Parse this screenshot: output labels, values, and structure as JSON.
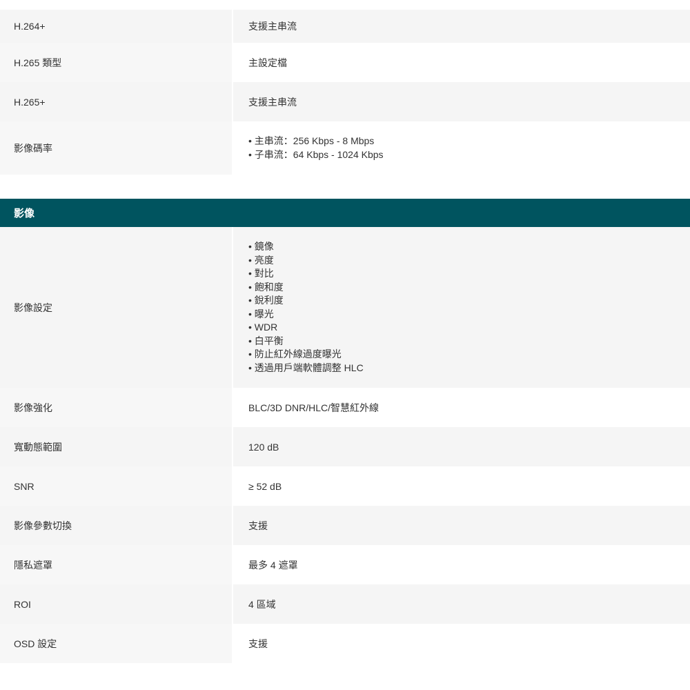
{
  "video_rows": [
    {
      "label": "H.264+",
      "value": "支援主串流"
    },
    {
      "label": "H.265 類型",
      "value": "主設定檔"
    },
    {
      "label": "H.265+",
      "value": "支援主串流"
    }
  ],
  "bitrate_row": {
    "label": "影像碼率",
    "items": [
      "主串流：256 Kbps - 8 Mbps",
      "子串流：64 Kbps - 1024 Kbps"
    ]
  },
  "image_section": {
    "title": "影像",
    "settings_row": {
      "label": "影像設定",
      "items": [
        "鏡像",
        "亮度",
        "對比",
        "飽和度",
        "銳利度",
        "曝光",
        "WDR",
        "白平衡",
        "防止紅外線過度曝光",
        "透過用戶端軟體調整 HLC"
      ]
    },
    "rows": [
      {
        "label": "影像強化",
        "value": "BLC/3D DNR/HLC/智慧紅外線"
      },
      {
        "label": "寬動態範圍",
        "value": "120 dB"
      },
      {
        "label": "SNR",
        "value": "≥ 52 dB"
      },
      {
        "label": "影像參數切換",
        "value": "支援"
      },
      {
        "label": "隱私遮罩",
        "value": "最多 4 遮罩"
      },
      {
        "label": "ROI",
        "value": "4 區域"
      },
      {
        "label": "OSD 設定",
        "value": "支援"
      }
    ]
  }
}
